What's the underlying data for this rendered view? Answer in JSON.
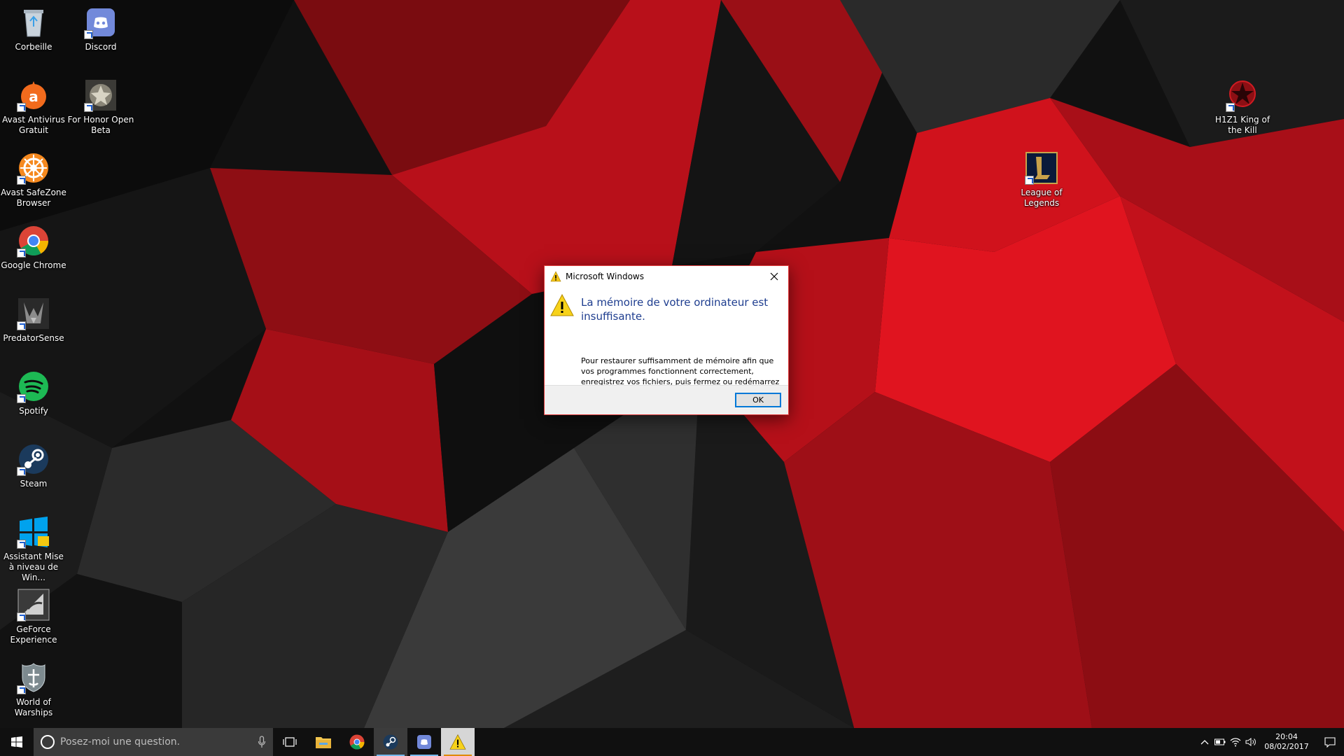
{
  "desktop": {
    "icons": [
      {
        "label": "Corbeille",
        "icon": "recycle-bin-icon"
      },
      {
        "label": "Discord",
        "icon": "discord-icon"
      },
      {
        "label": "Avast Antivirus Gratuit",
        "icon": "avast-icon"
      },
      {
        "label": "For Honor Open Beta",
        "icon": "for-honor-icon"
      },
      {
        "label": "Avast SafeZone Browser",
        "icon": "avast-safezone-icon"
      },
      {
        "label": "Google Chrome",
        "icon": "chrome-icon"
      },
      {
        "label": "PredatorSense",
        "icon": "predatorsense-icon"
      },
      {
        "label": "Spotify",
        "icon": "spotify-icon"
      },
      {
        "label": "Steam",
        "icon": "steam-icon"
      },
      {
        "label": "Assistant Mise à niveau de Win...",
        "icon": "windows-upgrade-icon"
      },
      {
        "label": "GeForce Experience",
        "icon": "geforce-icon"
      },
      {
        "label": "World of Warships",
        "icon": "world-of-warships-icon"
      },
      {
        "label": "H1Z1 King of the Kill",
        "icon": "h1z1-icon"
      },
      {
        "label": "League of Legends",
        "icon": "league-of-legends-icon"
      }
    ]
  },
  "dialog": {
    "title": "Microsoft Windows",
    "heading": "La mémoire de votre ordinateur est insuffisante.",
    "message": "Pour restaurer suffisamment de mémoire afin que vos programmes fonctionnent correctement, enregistrez vos fichiers, puis fermez ou redémarrez tous les programmes ouverts.",
    "ok_label": "OK"
  },
  "taskbar": {
    "search_placeholder": "Posez-moi une question.",
    "pinned": [
      "task-view",
      "file-explorer",
      "chrome",
      "steam",
      "discord",
      "memory-warning"
    ],
    "clock": {
      "time": "20:04",
      "date": "08/02/2017"
    }
  },
  "colors": {
    "dialog_heading": "#1e3d8f",
    "accent": "#0078d7",
    "wallpaper_red": "#c8101a"
  }
}
